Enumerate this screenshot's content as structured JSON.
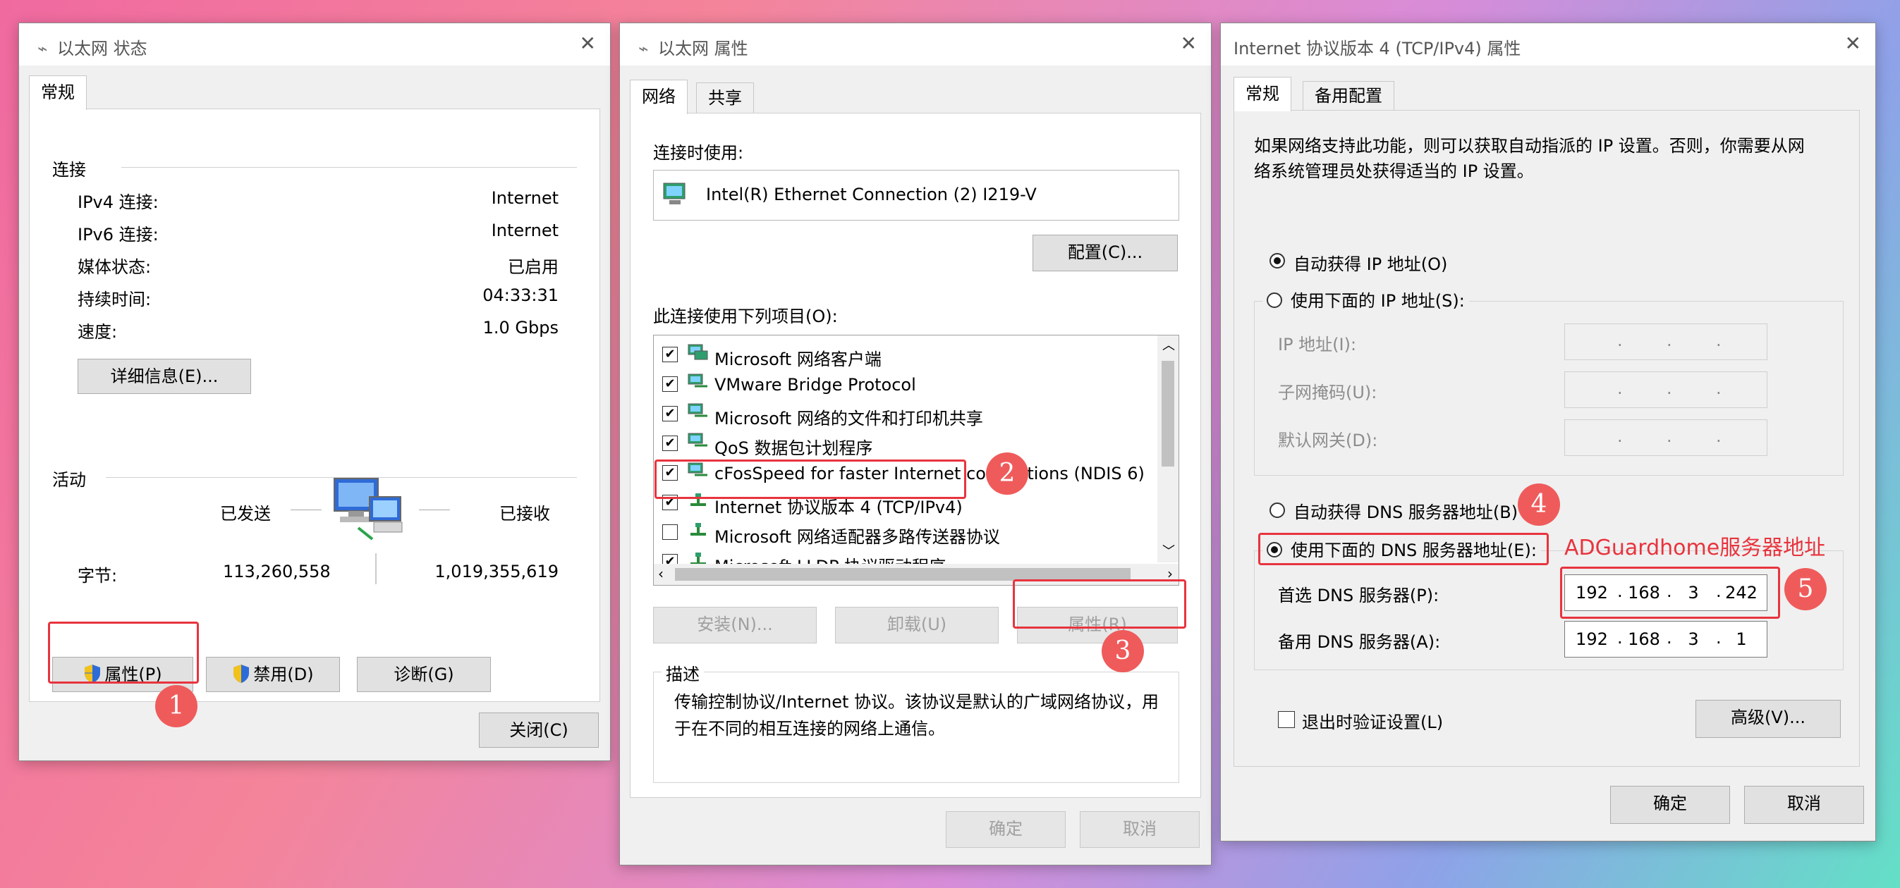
{
  "status_window": {
    "title": "以太网 状态",
    "tab": "常规",
    "connection_label": "连接",
    "rows": [
      {
        "label": "IPv4 连接:",
        "value": "Internet"
      },
      {
        "label": "IPv6 连接:",
        "value": "Internet"
      },
      {
        "label": "媒体状态:",
        "value": "已启用"
      },
      {
        "label": "持续时间:",
        "value": "04:33:31"
      },
      {
        "label": "速度:",
        "value": "1.0 Gbps"
      }
    ],
    "details_button": "详细信息(E)...",
    "activity_label": "活动",
    "sent_label": "已发送",
    "received_label": "已接收",
    "bytes_label": "字节:",
    "bytes_sent": "113,260,558",
    "bytes_received": "1,019,355,619",
    "properties_button": "属性(P)",
    "disable_button": "禁用(D)",
    "diagnose_button": "诊断(G)",
    "close_button": "关闭(C)"
  },
  "properties_window": {
    "title": "以太网 属性",
    "tabs": [
      "网络",
      "共享"
    ],
    "connect_using_label": "连接时使用:",
    "adapter_name": "Intel(R) Ethernet Connection (2) I219-V",
    "configure_button": "配置(C)...",
    "items_label": "此连接使用下列项目(O):",
    "items": [
      {
        "checked": true,
        "label": "Microsoft 网络客户端"
      },
      {
        "checked": true,
        "label": "VMware Bridge Protocol"
      },
      {
        "checked": true,
        "label": "Microsoft 网络的文件和打印机共享"
      },
      {
        "checked": true,
        "label": "QoS 数据包计划程序"
      },
      {
        "checked": true,
        "label": "cFosSpeed for faster Internet connections (NDIS 6)"
      },
      {
        "checked": true,
        "label": "Internet 协议版本 4 (TCP/IPv4)"
      },
      {
        "checked": false,
        "label": "Microsoft 网络适配器多路传送器协议"
      },
      {
        "checked": true,
        "label": "Microsoft LLDP 协议驱动程序"
      }
    ],
    "install_button": "安装(N)...",
    "uninstall_button": "卸载(U)",
    "properties_button": "属性(R)",
    "description_label": "描述",
    "description_text": "传输控制协议/Internet 协议。该协议是默认的广域网络协议，用于在不同的相互连接的网络上通信。",
    "ok_button": "确定",
    "cancel_button": "取消"
  },
  "ipv4_window": {
    "title": "Internet 协议版本 4 (TCP/IPv4) 属性",
    "tabs": [
      "常规",
      "备用配置"
    ],
    "intro": "如果网络支持此功能，则可以获取自动指派的 IP 设置。否则，你需要从网络系统管理员处获得适当的 IP 设置。",
    "auto_ip_label": "自动获得 IP 地址(O)",
    "manual_ip_label": "使用下面的 IP 地址(S):",
    "ip_address_label": "IP 地址(I):",
    "subnet_label": "子网掩码(U):",
    "gateway_label": "默认网关(D):",
    "auto_dns_label": "自动获得 DNS 服务器地址(B)",
    "manual_dns_label": "使用下面的 DNS 服务器地址(E):",
    "preferred_dns_label": "首选 DNS 服务器(P):",
    "alternate_dns_label": "备用 DNS 服务器(A):",
    "preferred_dns": [
      "192",
      "168",
      "3",
      "242"
    ],
    "alternate_dns": [
      "192",
      "168",
      "3",
      "1"
    ],
    "validate_label": "退出时验证设置(L)",
    "advanced_button": "高级(V)...",
    "ok_button": "确定",
    "cancel_button": "取消"
  },
  "annotations": {
    "adguard_label": "ADGuardhome服务器地址",
    "badges": [
      "1",
      "2",
      "3",
      "4",
      "5"
    ]
  },
  "colors": {
    "annotation_red": "#e8343e",
    "badge_red": "#ef5b5b"
  }
}
